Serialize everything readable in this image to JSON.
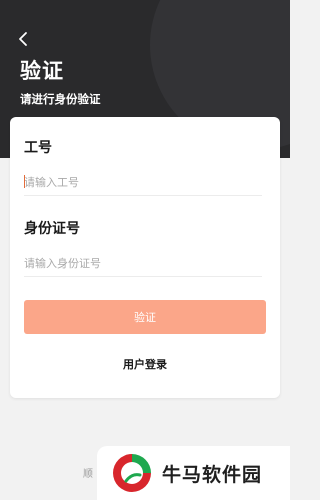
{
  "header": {
    "back_icon": "chevron-left-icon",
    "title": "验证",
    "subtitle": "请进行身份验证"
  },
  "form": {
    "employee_id": {
      "label": "工号",
      "placeholder": "请输入工号",
      "value": ""
    },
    "id_number": {
      "label": "身份证号",
      "placeholder": "请输入身份证号",
      "value": ""
    },
    "verify_button_label": "验证",
    "login_link_label": "用户登录"
  },
  "footer": {
    "partial_text": "顺"
  },
  "watermark": {
    "logo_icon": "niuma-logo-icon",
    "text": "牛马软件园"
  },
  "colors": {
    "header_bg": "#2a2a2c",
    "button_bg": "#fba689",
    "cursor": "#e36c3a",
    "page_bg": "#f2f2f2"
  }
}
